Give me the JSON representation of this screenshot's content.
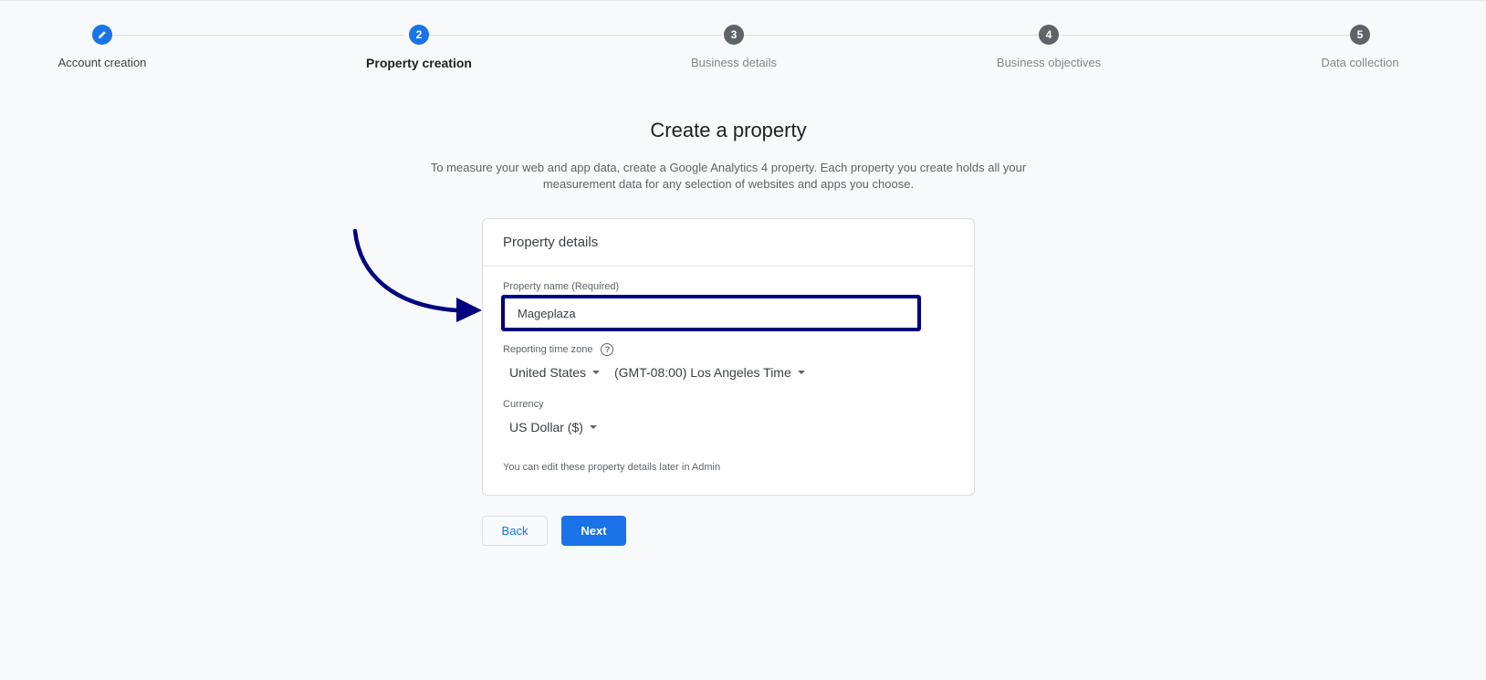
{
  "stepper": {
    "steps": [
      {
        "number": "",
        "label": "Account creation",
        "state": "done",
        "icon": "pencil-icon"
      },
      {
        "number": "2",
        "label": "Property creation",
        "state": "active"
      },
      {
        "number": "3",
        "label": "Business details",
        "state": "pending"
      },
      {
        "number": "4",
        "label": "Business objectives",
        "state": "pending"
      },
      {
        "number": "5",
        "label": "Data collection",
        "state": "pending"
      }
    ]
  },
  "page": {
    "title": "Create a property",
    "subtitle_line1": "To measure your web and app data, create a Google Analytics 4 property. Each property you create holds all your",
    "subtitle_line2": "measurement data for any selection of websites and apps you choose."
  },
  "card": {
    "header": "Property details",
    "property_name": {
      "label": "Property name (Required)",
      "value": "Mageplaza"
    },
    "time_zone": {
      "label": "Reporting time zone",
      "help_icon": "?",
      "country": "United States",
      "zone": "(GMT-08:00) Los Angeles Time"
    },
    "currency": {
      "label": "Currency",
      "value": "US Dollar ($)"
    },
    "hint": "You can edit these property details later in Admin"
  },
  "actions": {
    "back_label": "Back",
    "next_label": "Next"
  },
  "colors": {
    "accent": "#1a73e8",
    "annotation": "#000080",
    "background": "#f8f9fb"
  }
}
